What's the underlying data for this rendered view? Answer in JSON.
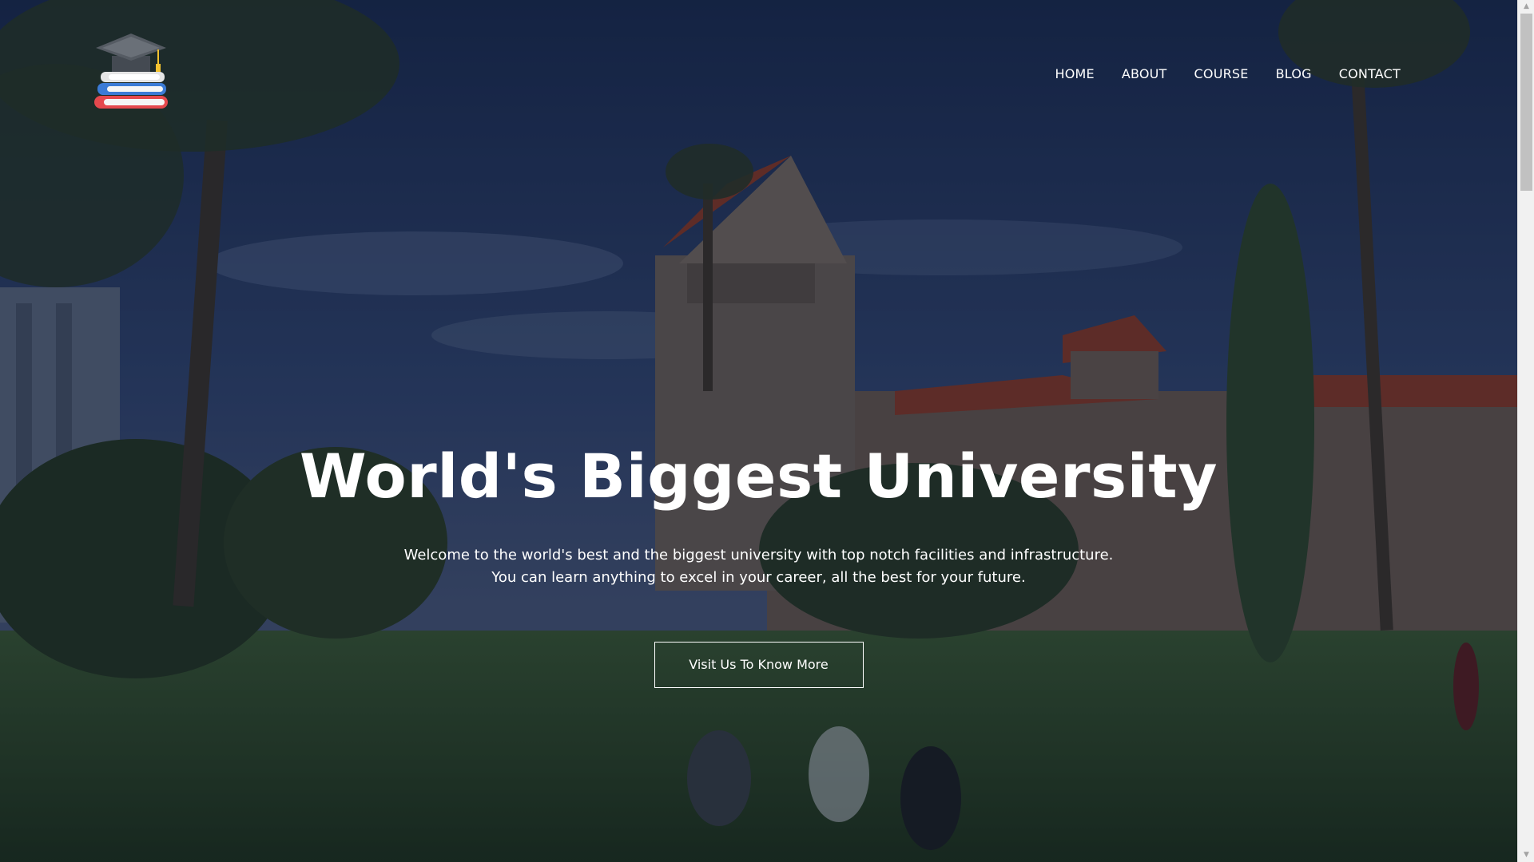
{
  "logo": {
    "alt": "University logo",
    "icon": "graduation-cap-books-icon"
  },
  "nav": {
    "items": [
      {
        "label": "HOME"
      },
      {
        "label": "ABOUT"
      },
      {
        "label": "COURSE"
      },
      {
        "label": "BLOG"
      },
      {
        "label": "CONTACT"
      }
    ]
  },
  "hero": {
    "title": "World's Biggest University",
    "subtitle_line1": "Welcome to the world's best and the biggest university with top notch facilities and infrastructure.",
    "subtitle_line2": "You can learn anything to excel in your career, all the best for your future.",
    "button_label": "Visit Us To Know More",
    "background_description": "campus-photo"
  },
  "colors": {
    "text": "#ffffff",
    "overlay": "#0a142d",
    "sky": "#2a3e68",
    "grass": "#2f4a2a",
    "roof": "#9a3a25"
  },
  "scrollbar": {
    "up_icon": "arrow-up-icon",
    "down_icon": "arrow-down-icon"
  }
}
